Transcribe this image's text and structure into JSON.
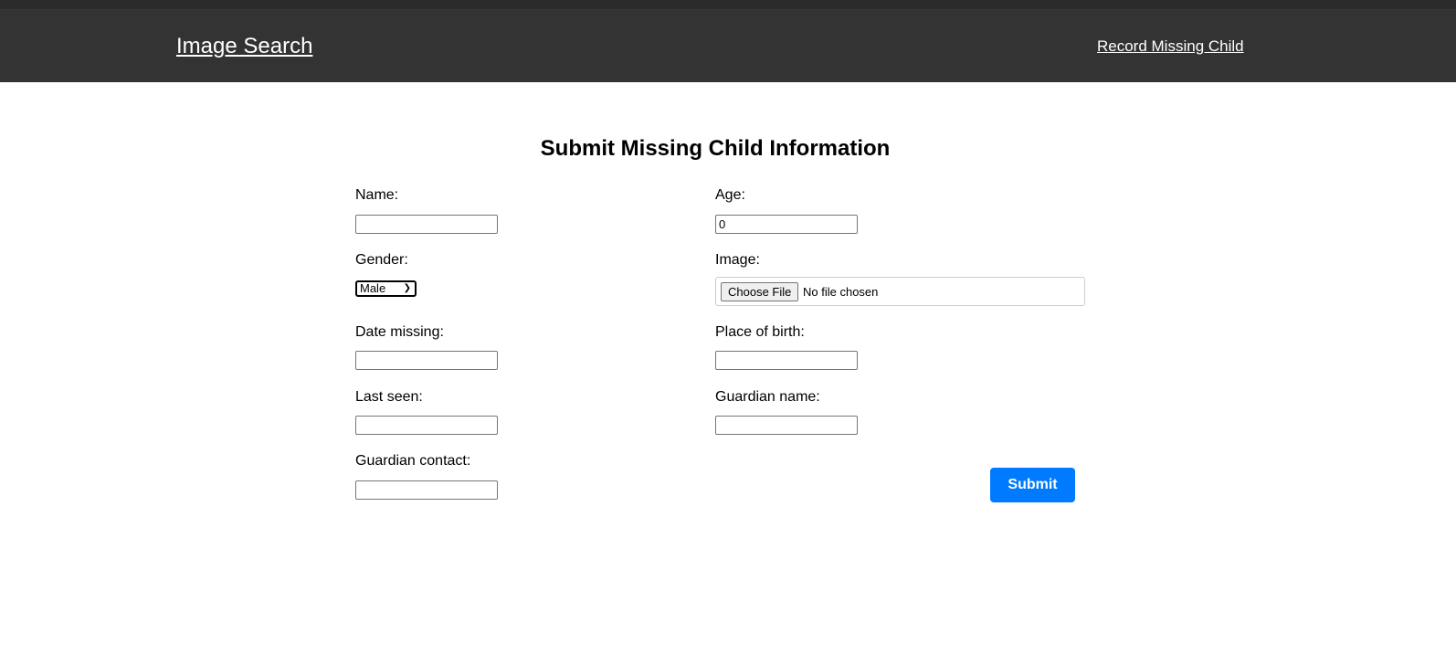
{
  "header": {
    "brand": "Image Search",
    "nav_link": "Record Missing Child"
  },
  "form": {
    "title": "Submit Missing Child Information",
    "name_label": "Name:",
    "name_value": "",
    "age_label": "Age:",
    "age_value": "0",
    "gender_label": "Gender:",
    "gender_value": "Male",
    "image_label": "Image:",
    "choose_file": "Choose File",
    "no_file": "No file chosen",
    "date_missing_label": "Date missing:",
    "place_of_birth_label": "Place of birth:",
    "last_seen_label": "Last seen:",
    "guardian_name_label": "Guardian name:",
    "guardian_contact_label": "Guardian contact:",
    "submit": "Submit"
  },
  "colors": {
    "header_bg": "#333333",
    "accent": "#007bff"
  }
}
